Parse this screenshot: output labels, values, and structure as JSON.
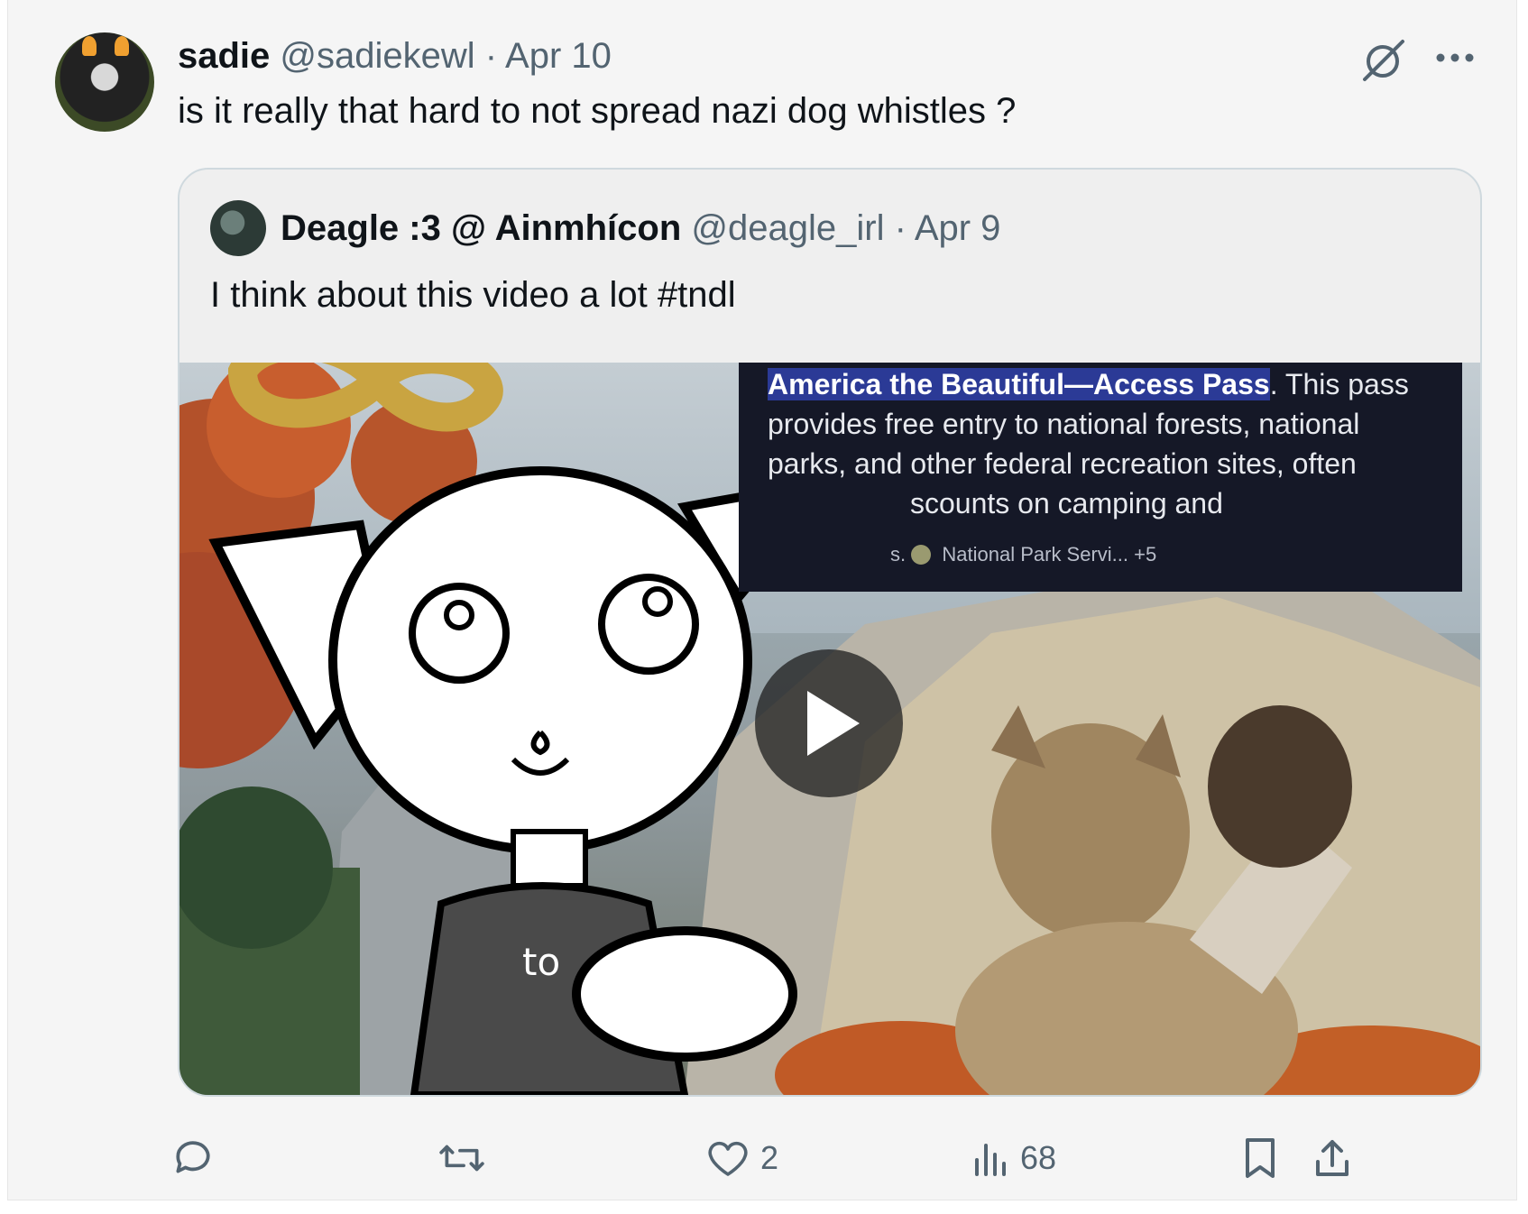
{
  "tweet": {
    "name": "sadie",
    "handle": "@sadiekewl",
    "separator": "·",
    "date": "Apr 10",
    "text": "is it really that hard to not spread nazi dog whistles ?"
  },
  "quote": {
    "name": "Deagle :3 @ Ainmhícon",
    "handle": "@deagle_irl",
    "separator": "·",
    "date": "Apr 9",
    "text": "I think about this video a lot #tndl",
    "media": {
      "overlay_highlight": "America the Beautiful—Access Pass",
      "overlay_line1_rest": ". This pass",
      "overlay_line2": "provides free entry to national forests, national",
      "overlay_line3": "parks, and other federal recreation sites, often",
      "overlay_line4": "scounts on camping and",
      "overlay_line5_prefix": "s.",
      "overlay_source": "National Park Servi...",
      "overlay_source_more": "+5",
      "shirt_text": "to"
    }
  },
  "actions": {
    "reply_count": "",
    "retweet_count": "",
    "like_count": "2",
    "views_count": "68"
  },
  "icons": [
    "grok-icon",
    "more-icon",
    "reply-icon",
    "retweet-icon",
    "like-icon",
    "views-icon",
    "bookmark-icon",
    "share-icon",
    "play-icon"
  ],
  "colors": {
    "text": "#0f1419",
    "secondary": "#536471",
    "border": "#cfd9de",
    "background": "#f5f5f5",
    "overlay_highlight": "#2b3a96"
  }
}
